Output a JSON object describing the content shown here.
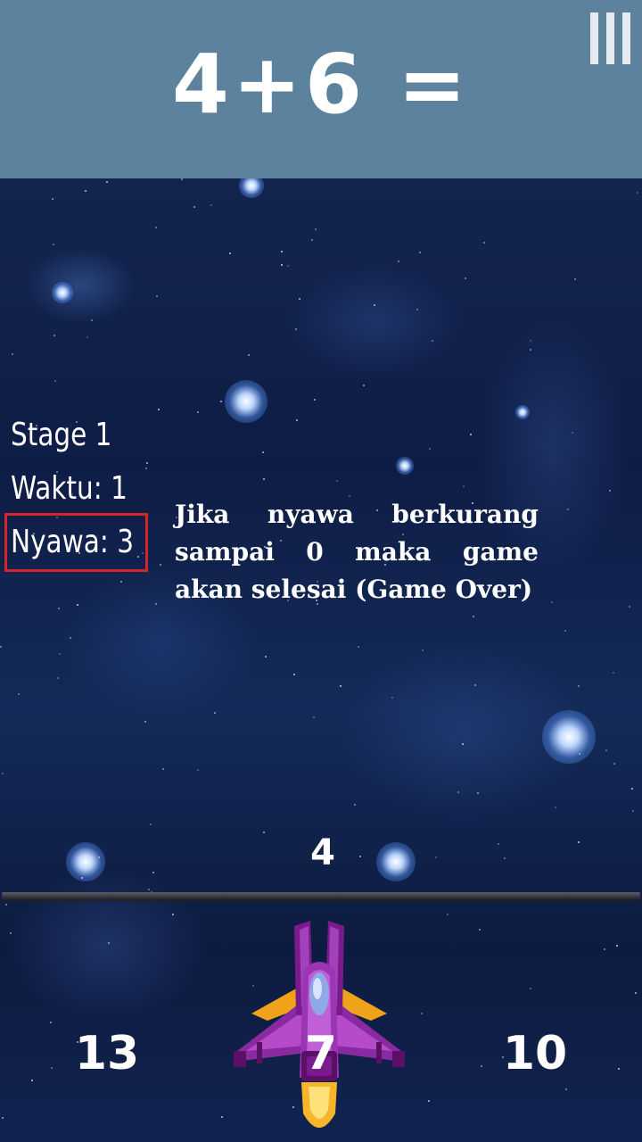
{
  "header": {
    "question": "4+6 =",
    "background_color": "#5c829d",
    "menu_icon": "menu-bars-icon"
  },
  "hud": {
    "stage": "Stage 1",
    "time": "Waktu: 1",
    "lives": "Nyawa: 3",
    "highlight_color": "#d7232a"
  },
  "tutorial": {
    "text": "Jika nyawa berkurang sampai 0 maka game akan selesai (Game Over)"
  },
  "falling_answer": "4",
  "answer_options": [
    "13",
    "7",
    "10"
  ],
  "player": {
    "ship_icon": "purple-fighter-jet-icon",
    "ship_colors": [
      "#7a1a8c",
      "#b54bc9",
      "#f0a21a"
    ]
  }
}
